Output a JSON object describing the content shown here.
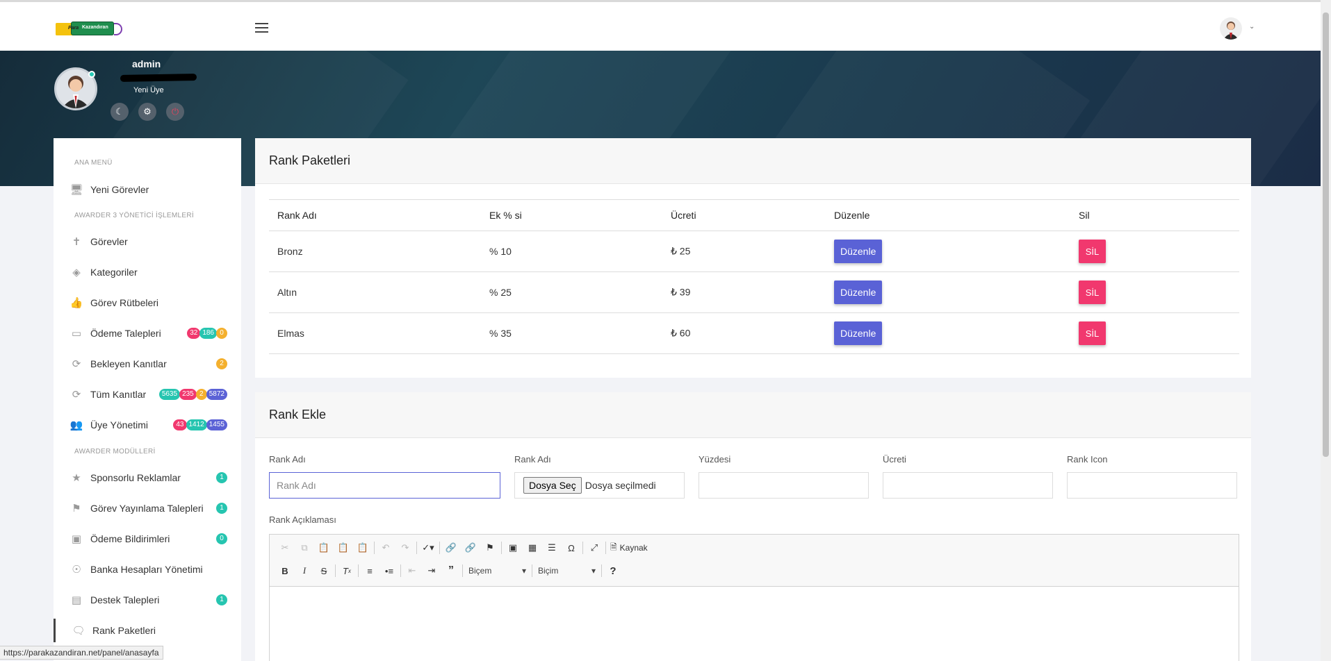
{
  "header": {
    "logo_text_left": "Para",
    "logo_text_right": "Kazandıran",
    "menu_icon": "hamburger-icon",
    "user_icon": "user-avatar"
  },
  "profile": {
    "name": "admin",
    "role": "Yeni Üye",
    "buttons": [
      "moon-icon",
      "gear-icon",
      "power-icon"
    ]
  },
  "sidebar": {
    "sections": {
      "main": "ANA MENÜ",
      "admin": "AWARDER 3 YÖNETİCİ İŞLEMLERİ",
      "modules": "AWARDER MODÜLLERİ"
    },
    "items": [
      {
        "label": "Yeni Görevler",
        "icon": "monitor-icon",
        "badges": []
      },
      {
        "label": "Görevler",
        "icon": "signpost-icon",
        "badges": []
      },
      {
        "label": "Kategoriler",
        "icon": "layers-icon",
        "badges": []
      },
      {
        "label": "Görev Rütbeleri",
        "icon": "thumbs-up-icon",
        "badges": []
      },
      {
        "label": "Ödeme Talepleri",
        "icon": "credit-card-icon",
        "badges": [
          {
            "v": "32",
            "c": "pink"
          },
          {
            "v": "186",
            "c": "teal"
          },
          {
            "v": "0",
            "c": "yellow"
          }
        ]
      },
      {
        "label": "Bekleyen Kanıtlar",
        "icon": "refresh-icon",
        "badges": [
          {
            "v": "2",
            "c": "yellow"
          }
        ]
      },
      {
        "label": "Tüm Kanıtlar",
        "icon": "refresh-icon",
        "badges": [
          {
            "v": "5635",
            "c": "teal"
          },
          {
            "v": "235",
            "c": "pink"
          },
          {
            "v": "2",
            "c": "yellow"
          },
          {
            "v": "5872",
            "c": "indigo"
          }
        ]
      },
      {
        "label": "Üye Yönetimi",
        "icon": "users-icon",
        "badges": [
          {
            "v": "43",
            "c": "pink"
          },
          {
            "v": "1412",
            "c": "teal"
          },
          {
            "v": "1455",
            "c": "indigo"
          }
        ]
      },
      {
        "label": "Sponsorlu Reklamlar",
        "icon": "star-icon",
        "badges": [
          {
            "v": "1",
            "c": "teal"
          }
        ]
      },
      {
        "label": "Görev Yayınlama Talepleri",
        "icon": "flag-icon",
        "badges": [
          {
            "v": "1",
            "c": "teal"
          }
        ]
      },
      {
        "label": "Ödeme Bildirimleri",
        "icon": "card-plus-icon",
        "badges": [
          {
            "v": "0",
            "c": "teal"
          }
        ]
      },
      {
        "label": "Banka Hesapları Yönetimi",
        "icon": "dollar-icon",
        "badges": []
      },
      {
        "label": "Destek Talepleri",
        "icon": "chat-icon",
        "badges": [
          {
            "v": "1",
            "c": "teal"
          }
        ]
      },
      {
        "label": "Rank Paketleri",
        "icon": "speech-icon",
        "badges": []
      }
    ]
  },
  "rank_table": {
    "title": "Rank Paketleri",
    "columns": [
      "Rank Adı",
      "Ek % si",
      "Ücreti",
      "Düzenle",
      "Sil"
    ],
    "rows": [
      {
        "name": "Bronz",
        "bonus": "% 10",
        "price": "₺ 25"
      },
      {
        "name": "Altın",
        "bonus": "% 25",
        "price": "₺ 39"
      },
      {
        "name": "Elmas",
        "bonus": "% 35",
        "price": "₺ 60"
      }
    ],
    "edit_label": "Düzenle",
    "delete_label": "SİL"
  },
  "rank_form": {
    "title": "Rank Ekle",
    "fields": {
      "name_label": "Rank Adı",
      "name_placeholder": "Rank Adı",
      "file_label": "Rank Adı",
      "file_button": "Dosya Seç",
      "file_status": "Dosya seçilmedi",
      "percent_label": "Yüzdesi",
      "price_label": "Ücreti",
      "icon_label": "Rank Icon"
    },
    "description_label": "Rank Açıklaması",
    "editor": {
      "source_label": "Kaynak",
      "format_combo_1": "Biçem",
      "format_combo_2": "Biçim"
    }
  },
  "status_bar": {
    "url": "https://parakazandiran.net/panel/anasayfa"
  }
}
